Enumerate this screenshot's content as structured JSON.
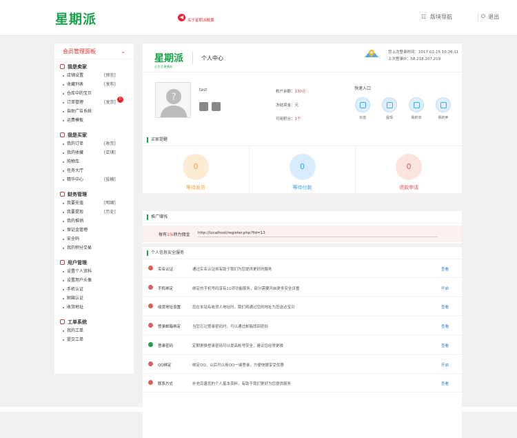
{
  "header": {
    "logo": "星期派",
    "notice": "关于星期派概要",
    "nav_label": "版块导航",
    "exit_label": "退出"
  },
  "sidebar": {
    "title": "会员管理面板",
    "groups": [
      {
        "title": "我是卖家",
        "items": [
          {
            "label": "店铺设置",
            "tag": "[预览]"
          },
          {
            "label": "收藏列表",
            "tag": "[发布]"
          },
          {
            "label": "仓库中的宝贝",
            "tag": ""
          },
          {
            "label": "订单管理",
            "tag": "[发货]",
            "badge": "0"
          },
          {
            "label": "自助广告系统",
            "tag": ""
          },
          {
            "label": "运费模板",
            "tag": ""
          }
        ]
      },
      {
        "title": "我是买家",
        "items": [
          {
            "label": "我的订单",
            "tag": "[收货]"
          },
          {
            "label": "我的收藏",
            "tag": "[店铺]"
          },
          {
            "label": "购物车",
            "tag": ""
          },
          {
            "label": "任务大厅",
            "tag": ""
          },
          {
            "label": "精华中心",
            "tag": "[投稿]"
          }
        ]
      },
      {
        "title": "财务管理",
        "items": [
          {
            "label": "我要充值",
            "tag": "[明细]"
          },
          {
            "label": "我要提现",
            "tag": "[历史]"
          },
          {
            "label": "我的推销",
            "tag": ""
          },
          {
            "label": "保证金管理",
            "tag": ""
          },
          {
            "label": "安全码",
            "tag": ""
          },
          {
            "label": "我的积分交易",
            "tag": ""
          }
        ]
      },
      {
        "title": "用户管理",
        "items": [
          {
            "label": "设置个人资料",
            "tag": ""
          },
          {
            "label": "设置用户头像",
            "tag": ""
          },
          {
            "label": "手机认证",
            "tag": ""
          },
          {
            "label": "邮箱认证",
            "tag": ""
          },
          {
            "label": "收货地址",
            "tag": ""
          }
        ]
      },
      {
        "title": "工单系统",
        "items": [
          {
            "label": "我的工单",
            "tag": ""
          },
          {
            "label": "提交工单",
            "tag": ""
          }
        ]
      }
    ]
  },
  "main": {
    "logo": "星期派",
    "logo_sub": "让生活更精彩",
    "title": "个人中心",
    "last_login_time": "您上次登录时间：2017-02-15 10:26:11",
    "last_login_ip": "上次登录IP：58.218.207.219",
    "username": "test",
    "account": {
      "balance_label": "帐户余额：",
      "balance_value": "130元",
      "deposit_label": "冻结资金：",
      "deposit_value": "元",
      "points_label": "可用积分：",
      "points_value": "1个"
    },
    "quick_title": "快速入口",
    "quick_items": [
      "充值",
      "提现",
      "我的买",
      "我的卖"
    ]
  },
  "remind": {
    "title": "买家提醒",
    "stats": [
      {
        "value": "0",
        "label": "等待发货",
        "color": "#e9a23b",
        "bg": "#fdebd3"
      },
      {
        "value": "0",
        "label": "等待付款",
        "color": "#3aa0e6",
        "bg": "#d7ecfc"
      },
      {
        "value": "0",
        "label": "退款申请",
        "color": "#e05b5b",
        "bg": "#fce3dd"
      }
    ]
  },
  "promo": {
    "title": "推广赚钱",
    "label_pre": "每有",
    "label_pct": "1%",
    "label_post": "转为佣金",
    "url": "http://localhost/register.php?fid=13"
  },
  "security": {
    "title": "个人信息安全服务",
    "rows": [
      {
        "name": "实名认证",
        "desc": "通过实名认证将有助于我们为您提供更好的服务",
        "action": "查看",
        "ok": false
      },
      {
        "name": "手机绑定",
        "desc": "绑定的手机号码享有11项功能服务，部分需要开启更多安全设置",
        "action": "开启",
        "ok": false
      },
      {
        "name": "收货地址设置",
        "desc": "您在本站有收货人地址时，我们将通过您的地址为您送达宝贝",
        "action": "查看",
        "ok": false
      },
      {
        "name": "登录邮箱绑定",
        "desc": "当您忘记登录密码时，可以通过邮箱找回密码",
        "action": "查看",
        "ok": false
      },
      {
        "name": "登录密码",
        "desc": "定期更换登录密码可以提高帐号安全，建议您经常更换",
        "action": "查看",
        "ok": true
      },
      {
        "name": "QQ绑定",
        "desc": "绑定QQ，以后可以用QQ一键登录，方便快捷享受优惠",
        "action": "开启",
        "ok": false
      },
      {
        "name": "联系方式",
        "desc": "补充完善您的个人基本资料，有助于我们更好为您提供服务",
        "action": "查看",
        "ok": false
      }
    ]
  }
}
